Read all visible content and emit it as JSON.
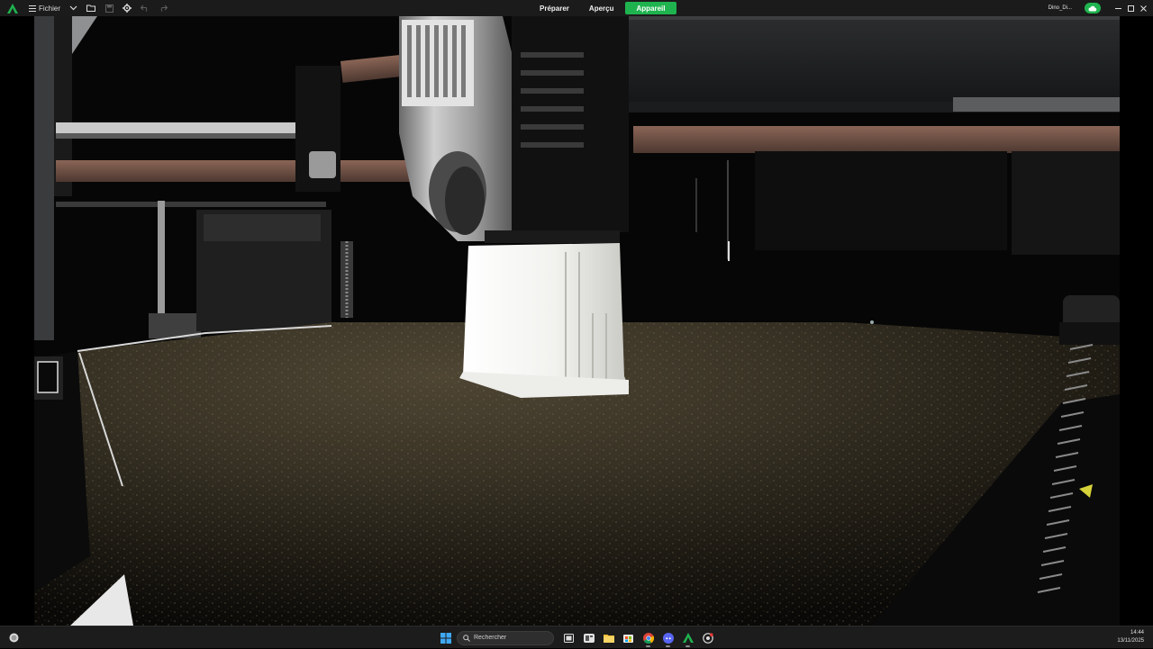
{
  "titlebar": {
    "menu_label": "Fichier",
    "tabs": [
      {
        "label": "Préparer",
        "active": false
      },
      {
        "label": "Aperçu",
        "active": false
      },
      {
        "label": "Appareil",
        "active": true
      }
    ],
    "device_name": "Dino_Di...",
    "accent_color": "#1fb34f",
    "icons": [
      "app-logo-icon",
      "hamburger-icon",
      "chevron-down-icon",
      "folder-icon",
      "save-icon",
      "gear-icon",
      "undo-icon",
      "redo-icon",
      "cloud-sync-icon",
      "minimize-icon",
      "maximize-icon",
      "close-icon"
    ]
  },
  "camera": {
    "description_icon": "camera-feed"
  },
  "taskbar": {
    "search_placeholder": "Rechercher",
    "time": "14:44",
    "date": "13/11/2025",
    "apps": [
      "windows-start-icon",
      "search-icon",
      "task-view-icon",
      "widgets-icon",
      "file-explorer-icon",
      "store-icon",
      "chrome-icon",
      "discord-icon",
      "slicer-app-icon",
      "recorder-icon"
    ]
  }
}
